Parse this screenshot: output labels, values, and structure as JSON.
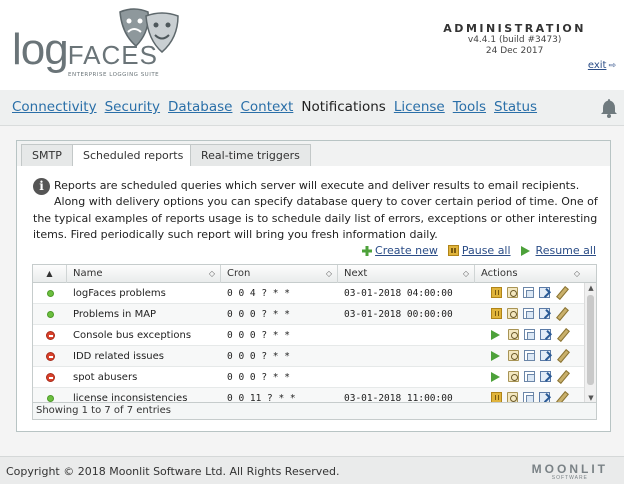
{
  "header": {
    "logo_log": "log",
    "logo_faces": "FACES",
    "logo_suite": "ENTERPRISE LOGGING SUITE",
    "admin_title": "ADMINISTRATION",
    "version": "v4.4.1 (build #3473)",
    "date": "24 Dec 2017",
    "exit": "exit"
  },
  "nav": {
    "items": [
      "Connectivity",
      "Security",
      "Database",
      "Context",
      "Notifications",
      "License",
      "Tools",
      "Status"
    ],
    "current": "Notifications",
    "bell_icon": "bell-icon"
  },
  "tabs": [
    {
      "label": "SMTP",
      "active": false
    },
    {
      "label": "Scheduled reports",
      "active": true
    },
    {
      "label": "Real-time triggers",
      "active": false
    }
  ],
  "info": {
    "text": "Reports are scheduled queries which server will execute and deliver results to email recipients. Along with delivery options you can specify database query to cover certain period of time. One of the typical examples of reports usage is to schedule daily list of errors, exceptions or other interesting items. Fired periodically such report will bring you fresh information daily."
  },
  "toolbar": {
    "create_new": "Create new",
    "pause_all": "Pause all",
    "resume_all": "Resume all"
  },
  "grid": {
    "columns": [
      "",
      "Name",
      "Cron",
      "Next",
      "Actions"
    ],
    "rows": [
      {
        "status": "active",
        "name": "logFaces problems",
        "cron": "0 0 4 ? * *",
        "next": "03-01-2018 04:00:00",
        "toggle": "pause"
      },
      {
        "status": "active",
        "name": "Problems in MAP",
        "cron": "0 0 0 ? * *",
        "next": "03-01-2018 00:00:00",
        "toggle": "pause"
      },
      {
        "status": "stopped",
        "name": "Console bus exceptions",
        "cron": "0 0 0 ? * *",
        "next": "",
        "toggle": "play"
      },
      {
        "status": "stopped",
        "name": "IDD related issues",
        "cron": "0 0 0 ? * *",
        "next": "",
        "toggle": "play"
      },
      {
        "status": "stopped",
        "name": "spot abusers",
        "cron": "0 0 0 ? * *",
        "next": "",
        "toggle": "play"
      },
      {
        "status": "active",
        "name": "license inconsistencies",
        "cron": "0 0 11 ? * *",
        "next": "03-01-2018 11:00:00",
        "toggle": "pause"
      }
    ],
    "footer": "Showing 1 to 7 of 7 entries"
  },
  "colors": {
    "link": "#2a6fa8",
    "active_status": "#6cbf3f",
    "stopped_status": "#d9412b"
  },
  "footer": {
    "copyright": "Copyright © 2018 Moonlit Software Ltd. All Rights Reserved.",
    "brand": "MOONLIT",
    "brand_sub": "SOFTWARE"
  }
}
